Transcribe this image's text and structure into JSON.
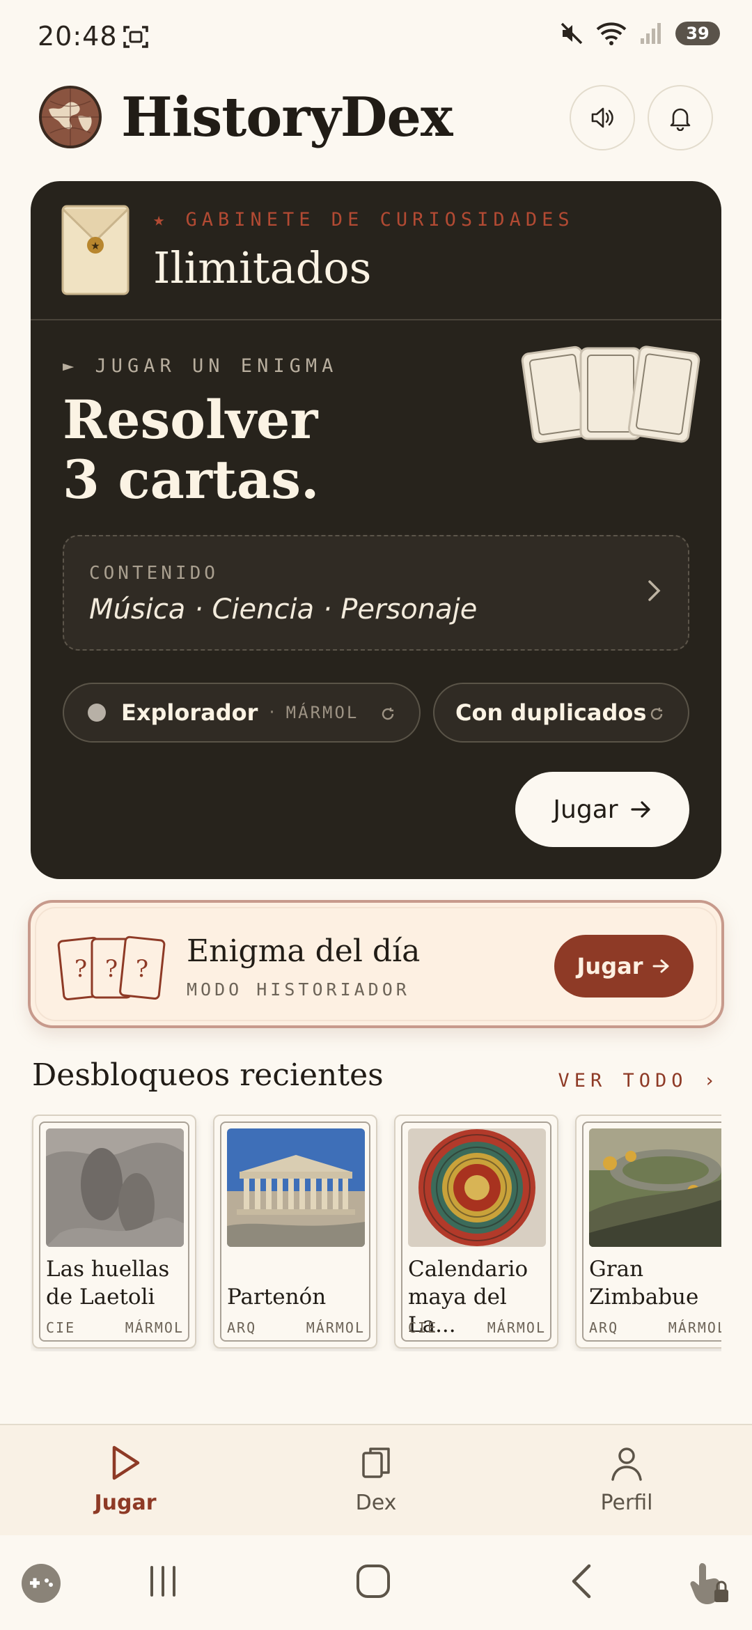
{
  "status_bar": {
    "time": "20:48",
    "battery": "39"
  },
  "header": {
    "title": "HistoryDex"
  },
  "cabinet": {
    "kicker": "★ GABINETE DE CURIOSIDADES",
    "title": "Ilimitados"
  },
  "enigma": {
    "label": "► JUGAR UN ENIGMA",
    "title_line1": "Resolver",
    "title_line2": "3 cartas.",
    "content_label": "CONTENIDO",
    "content_value": "Música · Ciencia · Personaje",
    "difficulty": "Explorador",
    "difficulty_sep": "·",
    "difficulty_tier": "MÁRMOL",
    "duplicates": "Con duplicados",
    "play_label": "Jugar"
  },
  "daily": {
    "title": "Enigma del día",
    "subtitle": "MODO HISTORIADOR",
    "play_label": "Jugar",
    "card_mark": "?"
  },
  "recent": {
    "title": "Desbloqueos recientes",
    "see_all": "VER TODO ›",
    "cards": [
      {
        "name_line1": "Las huellas",
        "name_line2": "de Laetoli",
        "category": "CIE",
        "tier": "MÁRMOL"
      },
      {
        "name_line1": "Partenón",
        "name_line2": "",
        "category": "ARQ",
        "tier": "MÁRMOL"
      },
      {
        "name_line1": "Calendario",
        "name_line2": "maya del La...",
        "category": "CIE",
        "tier": "MÁRMOL"
      },
      {
        "name_line1": "Gran",
        "name_line2": "Zimbabue",
        "category": "ARQ",
        "tier": "MÁRMOL"
      }
    ]
  },
  "bottom_nav": {
    "items": [
      {
        "label": "Jugar"
      },
      {
        "label": "Dex"
      },
      {
        "label": "Perfil"
      }
    ]
  },
  "colors": {
    "accent": "#8e3a26",
    "dark_card": "#27231c",
    "background": "#fcf8f1",
    "kicker": "#b24a33"
  }
}
